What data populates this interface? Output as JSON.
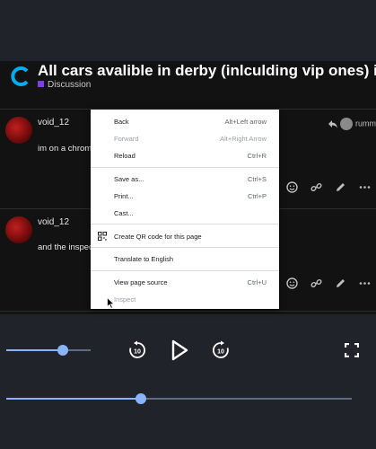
{
  "topic": {
    "title": "All cars avalible in derby (inlculding vip ones) in derby",
    "category": "Discussion",
    "category_color": "#7b3fe4"
  },
  "posts": [
    {
      "username": "void_12",
      "text": "im on a chrom",
      "reply_to": "rumm"
    },
    {
      "username": "void_12",
      "text": "and the inspec"
    }
  ],
  "context_menu": {
    "items": [
      {
        "label": "Back",
        "shortcut": "Alt+Left arrow"
      },
      {
        "label": "Forward",
        "shortcut": "Alt+Right Arrow"
      },
      {
        "label": "Reload",
        "shortcut": "Ctrl+R"
      },
      {
        "label": "Save as...",
        "shortcut": "Ctrl+S"
      },
      {
        "label": "Print...",
        "shortcut": "Ctrl+P"
      },
      {
        "label": "Cast...",
        "shortcut": ""
      },
      {
        "label": "Create QR code for this page",
        "shortcut": ""
      },
      {
        "label": "Translate to English",
        "shortcut": ""
      },
      {
        "label": "View page source",
        "shortcut": "Ctrl+U"
      },
      {
        "label": "Inspect",
        "shortcut": ""
      }
    ]
  },
  "player": {
    "volume": 0.67,
    "progress": 0.39,
    "accent": "#8ab4f8",
    "controls": [
      "replay-10-icon",
      "play-icon",
      "forward-10-icon",
      "fullscreen-icon"
    ]
  }
}
